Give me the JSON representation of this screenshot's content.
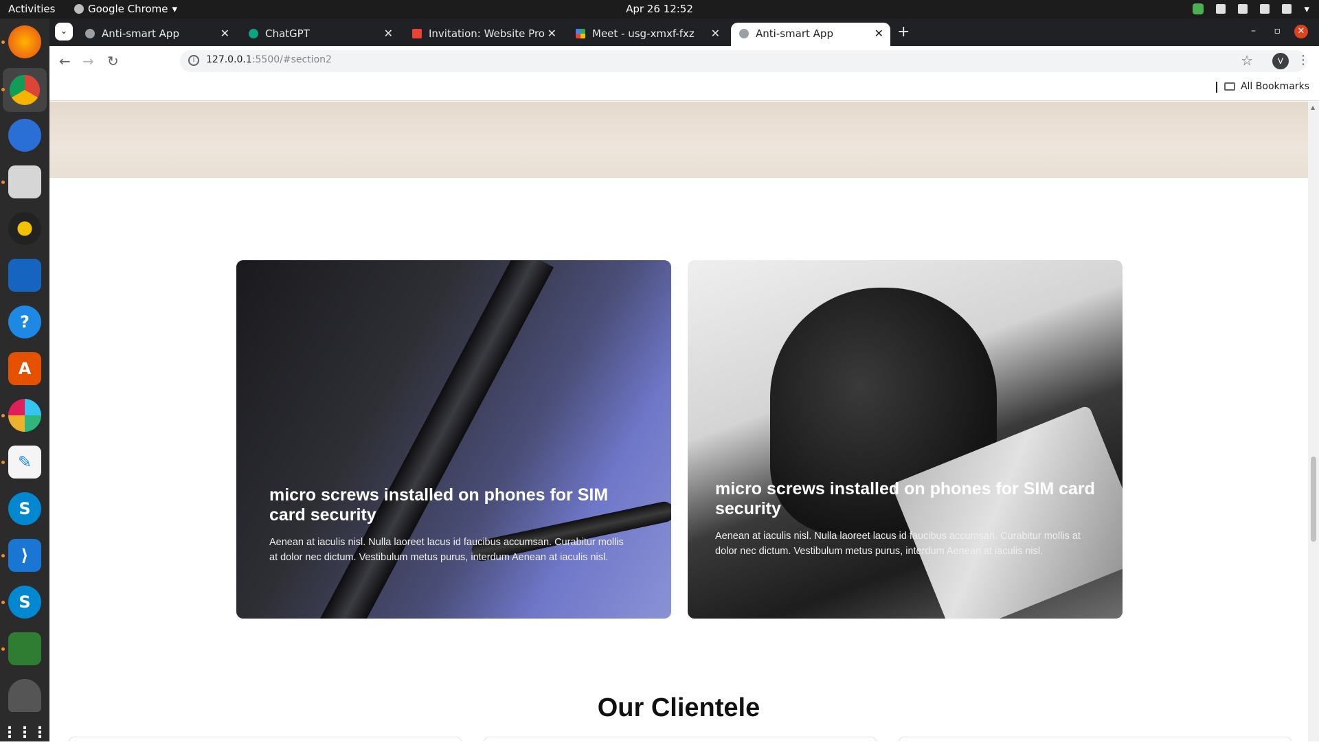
{
  "system": {
    "activities": "Activities",
    "app_name": "Google Chrome",
    "clock": "Apr 26  12:52"
  },
  "dock": {
    "items": [
      "firefox",
      "chrome",
      "thunderbird",
      "files",
      "rhythmbox",
      "libreoffice-impress",
      "help",
      "software-center",
      "slack",
      "text-editor",
      "skype",
      "vscode",
      "skype",
      "libreoffice-calc",
      "disk",
      "show-apps"
    ]
  },
  "browser": {
    "tabs": [
      {
        "title": "Anti-smart App",
        "active": false
      },
      {
        "title": "ChatGPT",
        "active": false
      },
      {
        "title": "Invitation: Website Prog",
        "active": false
      },
      {
        "title": "Meet - usg-xmxf-fxz",
        "active": false
      },
      {
        "title": "Anti-smart App",
        "active": true
      }
    ],
    "url_host": "127.0.0.1",
    "url_rest": ":5500/#section2",
    "profile_initial": "V",
    "bookmarks_label": "All Bookmarks"
  },
  "page": {
    "cards": [
      {
        "title": "micro screws installed on phones for SIM card security",
        "body": "Aenean at iaculis nisl. Nulla laoreet lacus id faucibus accumsan. Curabitur mollis at dolor nec dictum. Vestibulum metus purus, interdum Aenean at iaculis nisl."
      },
      {
        "title": "micro screws installed on phones for SIM card security",
        "body": "Aenean at iaculis nisl. Nulla laoreet lacus id faucibus accumsan. Curabitur mollis at dolor nec dictum. Vestibulum metus purus, interdum Aenean at iaculis nisl."
      }
    ],
    "clientele_heading": "Our Clientele"
  }
}
